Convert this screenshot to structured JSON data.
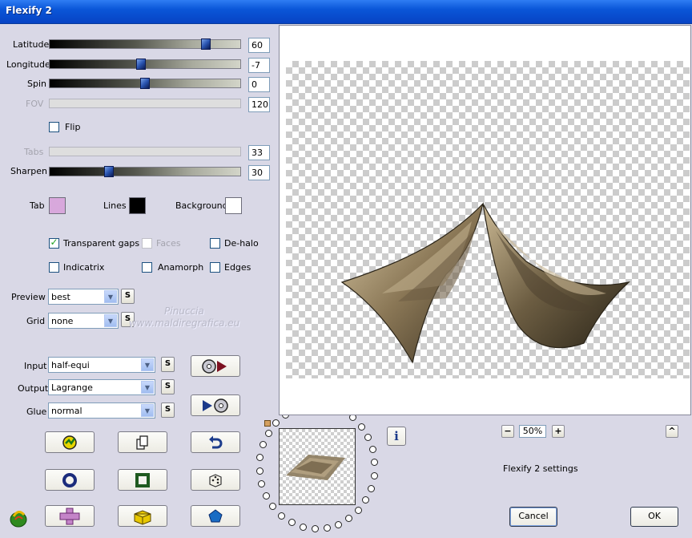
{
  "window": {
    "title": "Flexify 2"
  },
  "sliders": [
    {
      "label": "Latitude",
      "value": "60",
      "pos": 0.82,
      "enabled": true
    },
    {
      "label": "Longitude",
      "value": "-7",
      "pos": 0.48,
      "enabled": true
    },
    {
      "label": "Spin",
      "value": "0",
      "pos": 0.5,
      "enabled": true
    },
    {
      "label": "FOV",
      "value": "120",
      "enabled": false
    },
    {
      "label": "Tabs",
      "value": "33",
      "enabled": false
    },
    {
      "label": "Sharpen",
      "value": "30",
      "pos": 0.31,
      "enabled": true
    }
  ],
  "flip": {
    "label": "Flip",
    "checked": false
  },
  "colors": {
    "tab": {
      "label": "Tab",
      "color": "#d8a8dc"
    },
    "lines": {
      "label": "Lines",
      "color": "#000000"
    },
    "background": {
      "label": "Background",
      "color": "#ffffff"
    },
    "accent": "#21a121"
  },
  "options": {
    "transparent_gaps": {
      "label": "Transparent gaps",
      "checked": true
    },
    "faces": {
      "label": "Faces",
      "checked": false,
      "enabled": false
    },
    "de_halo": {
      "label": "De-halo",
      "checked": false
    },
    "indicatrix": {
      "label": "Indicatrix",
      "checked": false
    },
    "anamorph": {
      "label": "Anamorph",
      "checked": false
    },
    "edges": {
      "label": "Edges",
      "checked": false
    }
  },
  "preview_select": {
    "label": "Preview",
    "value": "best"
  },
  "grid_select": {
    "label": "Grid",
    "value": "none"
  },
  "input_select": {
    "label": "Input",
    "value": "half-equi"
  },
  "output_select": {
    "label": "Output",
    "value": "Lagrange"
  },
  "glue_select": {
    "label": "Glue",
    "value": "normal"
  },
  "s_button_label": "S",
  "watermark": {
    "line1": "Pinuccia",
    "line2": "www.maldiregrafica.eu"
  },
  "zoom": {
    "value": "50%",
    "minus": "−",
    "plus": "+"
  },
  "status_text": "Flexify 2 settings",
  "collapse_label": "^",
  "info_label": "i",
  "buttons": {
    "cancel": "Cancel",
    "ok": "OK"
  },
  "icons": {
    "animate": "animate-icon",
    "copy": "copy-icon",
    "undo": "undo-icon",
    "circle": "circle-icon",
    "square": "square-icon",
    "dice": "dice-icon",
    "cross": "cross-icon",
    "cube": "cube-icon",
    "pentagon": "pentagon-icon",
    "load": "load-icon",
    "save": "save-icon",
    "logo": "flexify-logo-icon"
  }
}
